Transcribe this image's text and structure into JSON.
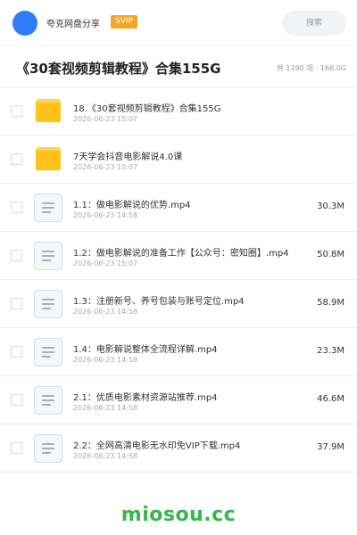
{
  "header": {
    "app_name": "夸克网盘分享",
    "badge": "SVIP",
    "search_placeholder": "搜索"
  },
  "folder": {
    "title": "《30套视频剪辑教程》合集155G",
    "meta": "共 1190 项 · 166.0G"
  },
  "files": [
    {
      "type": "folder",
      "name": "18.《30套视频剪辑教程》合集155G",
      "date": "2026-06-23 15:07",
      "size": ""
    },
    {
      "type": "folder",
      "name": "7天学会抖音电影解说4.0课",
      "date": "2026-06-23 15:07",
      "size": ""
    },
    {
      "type": "file",
      "name": "1.1：做电影解说的优势.mp4",
      "date": "2026-06-23 14:58",
      "size": "30.3M"
    },
    {
      "type": "file",
      "name": "1.2：做电影解说的准备工作【公众号：密知圈】.mp4",
      "date": "2026-06-23 15:07",
      "size": "50.8M"
    },
    {
      "type": "file",
      "name": "1.3：注册新号、养号包装与账号定位.mp4",
      "date": "2026-06-23 14:58",
      "size": "58.9M"
    },
    {
      "type": "file",
      "name": "1.4：电影解说整体全流程详解.mp4",
      "date": "2026-06-23 14:58",
      "size": "23.3M"
    },
    {
      "type": "file",
      "name": "2.1：优质电影素材资源站推荐.mp4",
      "date": "2026-06-23 14:58",
      "size": "46.6M"
    },
    {
      "type": "file",
      "name": "2.2：全网高清电影无水印免VIP下载.mp4",
      "date": "2026-06-23 14:58",
      "size": "37.9M"
    }
  ],
  "footer": {
    "watermark": "miosou.cc"
  },
  "colors": {
    "avatar": "#2f7cf6",
    "badge": "#f5a623",
    "folder": "#ffc21a",
    "watermark": "#39b54a"
  }
}
